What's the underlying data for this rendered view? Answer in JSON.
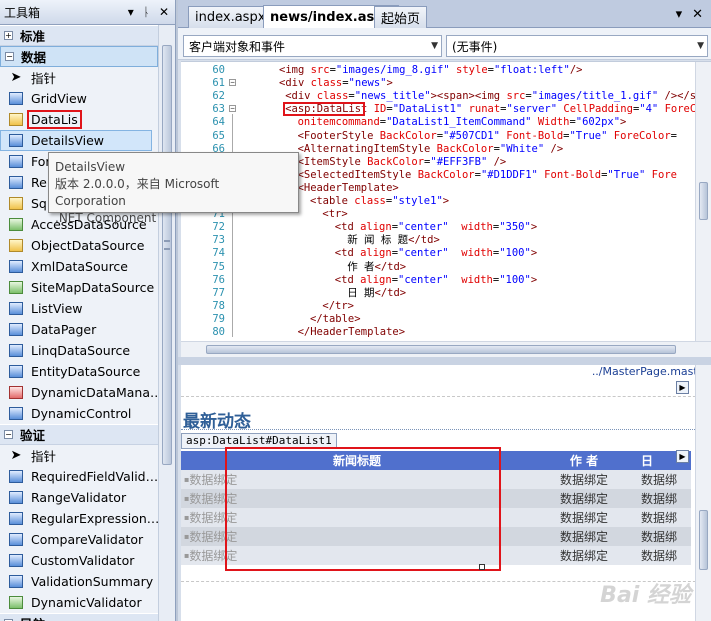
{
  "toolbox": {
    "title": "工具箱",
    "controls": [
      "▾",
      "ᚿ",
      "✕"
    ],
    "sections": [
      {
        "name": "标准",
        "expanded": false
      },
      {
        "name": "数据",
        "expanded": true
      },
      {
        "name": "验证",
        "expanded": true
      },
      {
        "name": "导航",
        "expanded": false
      }
    ],
    "data_items": [
      "指针",
      "GridView",
      "DataList",
      "DetailsView",
      "FormView",
      "Repeater",
      "SqlDataSource",
      "AccessDataSource",
      "ObjectDataSource",
      "XmlDataSource",
      "SiteMapDataSource",
      "ListView",
      "DataPager",
      "LinqDataSource",
      "EntityDataSource",
      "DynamicDataManager",
      "DynamicControl"
    ],
    "data_items_shown": [
      "指针",
      "GridView",
      "DataLis",
      "DetailsView",
      "For",
      "Rep",
      "Sql",
      "AccessDataSource",
      "ObjectDataSource",
      "XmlDataSource",
      "SiteMapDataSource",
      "ListView",
      "DataPager",
      "LinqDataSource",
      "EntityDataSource",
      "DynamicDataMana…",
      "DynamicControl"
    ],
    "validation_items": [
      "指针",
      "RequiredFieldValid…",
      "RangeValidator",
      "RegularExpression…",
      "CompareValidator",
      "CustomValidator",
      "ValidationSummary",
      "DynamicValidator"
    ],
    "last_section_partial": "导航"
  },
  "tooltip": {
    "title": "DetailsView",
    "line2": "版本 2.0.0.0，来自 Microsoft Corporation",
    "line3": ".NET Component"
  },
  "editor": {
    "tabs": [
      "index.aspx",
      "news/index.aspx",
      "起始页"
    ],
    "active_tab": "news/index.aspx",
    "tab_controls": [
      "▾",
      "✕"
    ],
    "client_objects_combo": "客户端对象和事件",
    "events_combo": "(无事件)",
    "code_lines": [
      {
        "n": "60",
        "indent": 0,
        "parts": [
          [
            "tg",
            "<img "
          ],
          [
            "at",
            "src"
          ],
          [
            "pl",
            "="
          ],
          [
            "vl",
            "\"images/img_8.gif\""
          ],
          [
            "pl",
            " "
          ],
          [
            "at",
            "style"
          ],
          [
            "pl",
            "="
          ],
          [
            "vl",
            "\"float:left\""
          ],
          [
            "tg",
            "/>"
          ]
        ]
      },
      {
        "n": "61",
        "indent": 0,
        "parts": [
          [
            "tg",
            "<div "
          ],
          [
            "at",
            "class"
          ],
          [
            "pl",
            "="
          ],
          [
            "vl",
            "\"news\""
          ],
          [
            "tg",
            ">"
          ]
        ]
      },
      {
        "n": "62",
        "indent": 1,
        "parts": [
          [
            "tg",
            "<div "
          ],
          [
            "at",
            "class"
          ],
          [
            "pl",
            "="
          ],
          [
            "vl",
            "\"news_title\""
          ],
          [
            "tg",
            "><span><img "
          ],
          [
            "at",
            "src"
          ],
          [
            "pl",
            "="
          ],
          [
            "vl",
            "\"images/title_1.gif\""
          ],
          [
            "pl",
            " "
          ],
          [
            "tg",
            "/></span>"
          ]
        ]
      },
      {
        "n": "63",
        "indent": 1,
        "parts": [
          [
            "tg",
            "<asp:DataList"
          ],
          [
            "pl",
            " "
          ],
          [
            "at",
            "ID"
          ],
          [
            "pl",
            "="
          ],
          [
            "vl",
            "\"DataList1\""
          ],
          [
            "pl",
            " "
          ],
          [
            "at",
            "runat"
          ],
          [
            "pl",
            "="
          ],
          [
            "vl",
            "\"server\""
          ],
          [
            "pl",
            " "
          ],
          [
            "at",
            "CellPadding"
          ],
          [
            "pl",
            "="
          ],
          [
            "vl",
            "\"4\""
          ],
          [
            "pl",
            " "
          ],
          [
            "at",
            "ForeColor"
          ]
        ]
      },
      {
        "n": "64",
        "indent": 3,
        "parts": [
          [
            "at",
            "onitemcommand"
          ],
          [
            "pl",
            "="
          ],
          [
            "vl",
            "\"DataList1_ItemCommand\""
          ],
          [
            "pl",
            " "
          ],
          [
            "at",
            "Width"
          ],
          [
            "pl",
            "="
          ],
          [
            "vl",
            "\"602px\""
          ],
          [
            "tg",
            ">"
          ]
        ]
      },
      {
        "n": "65",
        "indent": 3,
        "parts": [
          [
            "tg",
            "<FooterStyle "
          ],
          [
            "at",
            "BackColor"
          ],
          [
            "pl",
            "="
          ],
          [
            "vl",
            "\"#507CD1\""
          ],
          [
            "pl",
            " "
          ],
          [
            "at",
            "Font-Bold"
          ],
          [
            "pl",
            "="
          ],
          [
            "vl",
            "\"True\""
          ],
          [
            "pl",
            " "
          ],
          [
            "at",
            "ForeColor"
          ],
          [
            "pl",
            "="
          ]
        ]
      },
      {
        "n": "66",
        "indent": 3,
        "parts": [
          [
            "tg",
            "<AlternatingItemStyle "
          ],
          [
            "at",
            "BackColor"
          ],
          [
            "pl",
            "="
          ],
          [
            "vl",
            "\"White\""
          ],
          [
            "pl",
            " "
          ],
          [
            "tg",
            "/>"
          ]
        ]
      },
      {
        "n": "67",
        "indent": 3,
        "parts": [
          [
            "tg",
            "<ItemStyle "
          ],
          [
            "at",
            "BackColor"
          ],
          [
            "pl",
            "="
          ],
          [
            "vl",
            "\"#EFF3FB\""
          ],
          [
            "pl",
            " "
          ],
          [
            "tg",
            "/>"
          ]
        ]
      },
      {
        "n": "68",
        "indent": 3,
        "parts": [
          [
            "tg",
            "<SelectedItemStyle "
          ],
          [
            "at",
            "BackColor"
          ],
          [
            "pl",
            "="
          ],
          [
            "vl",
            "\"#D1DDF1\""
          ],
          [
            "pl",
            " "
          ],
          [
            "at",
            "Font-Bold"
          ],
          [
            "pl",
            "="
          ],
          [
            "vl",
            "\"True\""
          ],
          [
            "pl",
            " "
          ],
          [
            "at",
            "Fore"
          ]
        ]
      },
      {
        "n": "69",
        "indent": 3,
        "parts": [
          [
            "tg",
            "<HeaderTemplate>"
          ]
        ]
      },
      {
        "n": "70",
        "indent": 5,
        "parts": [
          [
            "tg",
            "<table "
          ],
          [
            "at",
            "class"
          ],
          [
            "pl",
            "="
          ],
          [
            "vl",
            "\"style1\""
          ],
          [
            "tg",
            ">"
          ]
        ]
      },
      {
        "n": "71",
        "indent": 7,
        "parts": [
          [
            "tg",
            "<tr>"
          ]
        ]
      },
      {
        "n": "72",
        "indent": 9,
        "parts": [
          [
            "tg",
            "<td "
          ],
          [
            "at",
            "align"
          ],
          [
            "pl",
            "="
          ],
          [
            "vl",
            "\"center\""
          ],
          [
            "pl",
            "  "
          ],
          [
            "at",
            "width"
          ],
          [
            "pl",
            "="
          ],
          [
            "vl",
            "\"350\""
          ],
          [
            "tg",
            ">"
          ]
        ]
      },
      {
        "n": "73",
        "indent": 11,
        "parts": [
          [
            "pl",
            "新 闻 标 题"
          ],
          [
            "tg",
            "</td>"
          ]
        ]
      },
      {
        "n": "74",
        "indent": 9,
        "parts": [
          [
            "tg",
            "<td "
          ],
          [
            "at",
            "align"
          ],
          [
            "pl",
            "="
          ],
          [
            "vl",
            "\"center\""
          ],
          [
            "pl",
            "  "
          ],
          [
            "at",
            "width"
          ],
          [
            "pl",
            "="
          ],
          [
            "vl",
            "\"100\""
          ],
          [
            "tg",
            ">"
          ]
        ]
      },
      {
        "n": "75",
        "indent": 11,
        "parts": [
          [
            "pl",
            "作 者"
          ],
          [
            "tg",
            "</td>"
          ]
        ]
      },
      {
        "n": "76",
        "indent": 9,
        "parts": [
          [
            "tg",
            "<td "
          ],
          [
            "at",
            "align"
          ],
          [
            "pl",
            "="
          ],
          [
            "vl",
            "\"center\""
          ],
          [
            "pl",
            "  "
          ],
          [
            "at",
            "width"
          ],
          [
            "pl",
            "="
          ],
          [
            "vl",
            "\"100\""
          ],
          [
            "tg",
            ">"
          ]
        ]
      },
      {
        "n": "77",
        "indent": 11,
        "parts": [
          [
            "pl",
            "日 期"
          ],
          [
            "tg",
            "</td>"
          ]
        ]
      },
      {
        "n": "78",
        "indent": 7,
        "parts": [
          [
            "tg",
            "</tr>"
          ]
        ]
      },
      {
        "n": "79",
        "indent": 5,
        "parts": [
          [
            "tg",
            "</table>"
          ]
        ]
      },
      {
        "n": "80",
        "indent": 3,
        "parts": [
          [
            "tg",
            "</HeaderTemplate>"
          ]
        ]
      }
    ]
  },
  "design": {
    "master_link": "../MasterPage.master",
    "section_title": "最新动态",
    "datalist_tag": "asp:DataList#DataList1",
    "header": [
      "新闻标题",
      "作 者",
      "日"
    ],
    "rows": [
      [
        "数据绑定",
        "数据绑定",
        "数据绑"
      ],
      [
        "数据绑定",
        "数据绑定",
        "数据绑"
      ],
      [
        "数据绑定",
        "数据绑定",
        "数据绑"
      ],
      [
        "数据绑定",
        "数据绑定",
        "数据绑"
      ],
      [
        "数据绑定",
        "数据绑定",
        "数据绑"
      ]
    ],
    "watermark": "Bai 经验"
  },
  "colors": {
    "accent_red": "#e00000",
    "grid_header": "#5070cd",
    "title_blue": "#2f5f97"
  }
}
